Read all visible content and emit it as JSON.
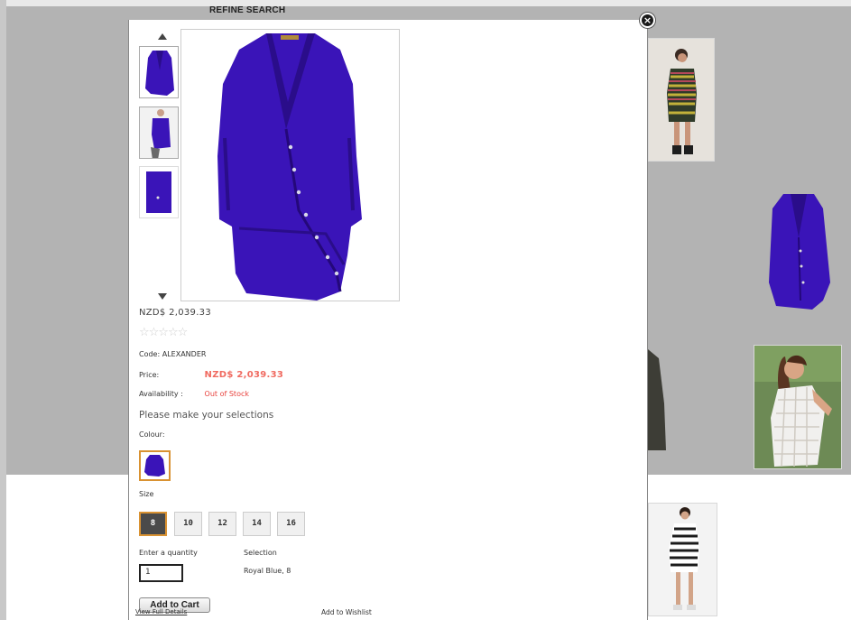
{
  "page": {
    "refine_label": "REFINE SEARCH"
  },
  "modal": {
    "close_symbol": "×",
    "price_top": "NZD$ 2,039.33",
    "stars": "☆☆☆☆☆",
    "code_label": "Code:",
    "code_value": "ALEXANDER",
    "price_label": "Price:",
    "price_value": "NZD$ 2,039.33",
    "availability_label": "Availability :",
    "availability_value": "Out of Stock",
    "selection_prompt": "Please make your selections",
    "colour_label": "Colour:",
    "size_label": "Size",
    "sizes": [
      "8",
      "10",
      "12",
      "14",
      "16"
    ],
    "selected_size": "8",
    "quantity_label": "Enter a quantity",
    "quantity_value": "1",
    "selection_label": "Selection",
    "selection_value": "Royal Blue, 8",
    "add_to_cart": "Add to Cart",
    "view_full_details": "View Full Details",
    "add_to_wishlist": "Add to Wishlist"
  },
  "colors": {
    "product": "#3a14b8",
    "accent_orange": "#d99232",
    "price_red": "#e8413c",
    "overlay_gray": "#b3b3b3"
  },
  "icons": {
    "close": "close-icon",
    "scroll_up": "arrow-up-icon",
    "scroll_down": "arrow-down-icon",
    "rating": "star-icon"
  }
}
